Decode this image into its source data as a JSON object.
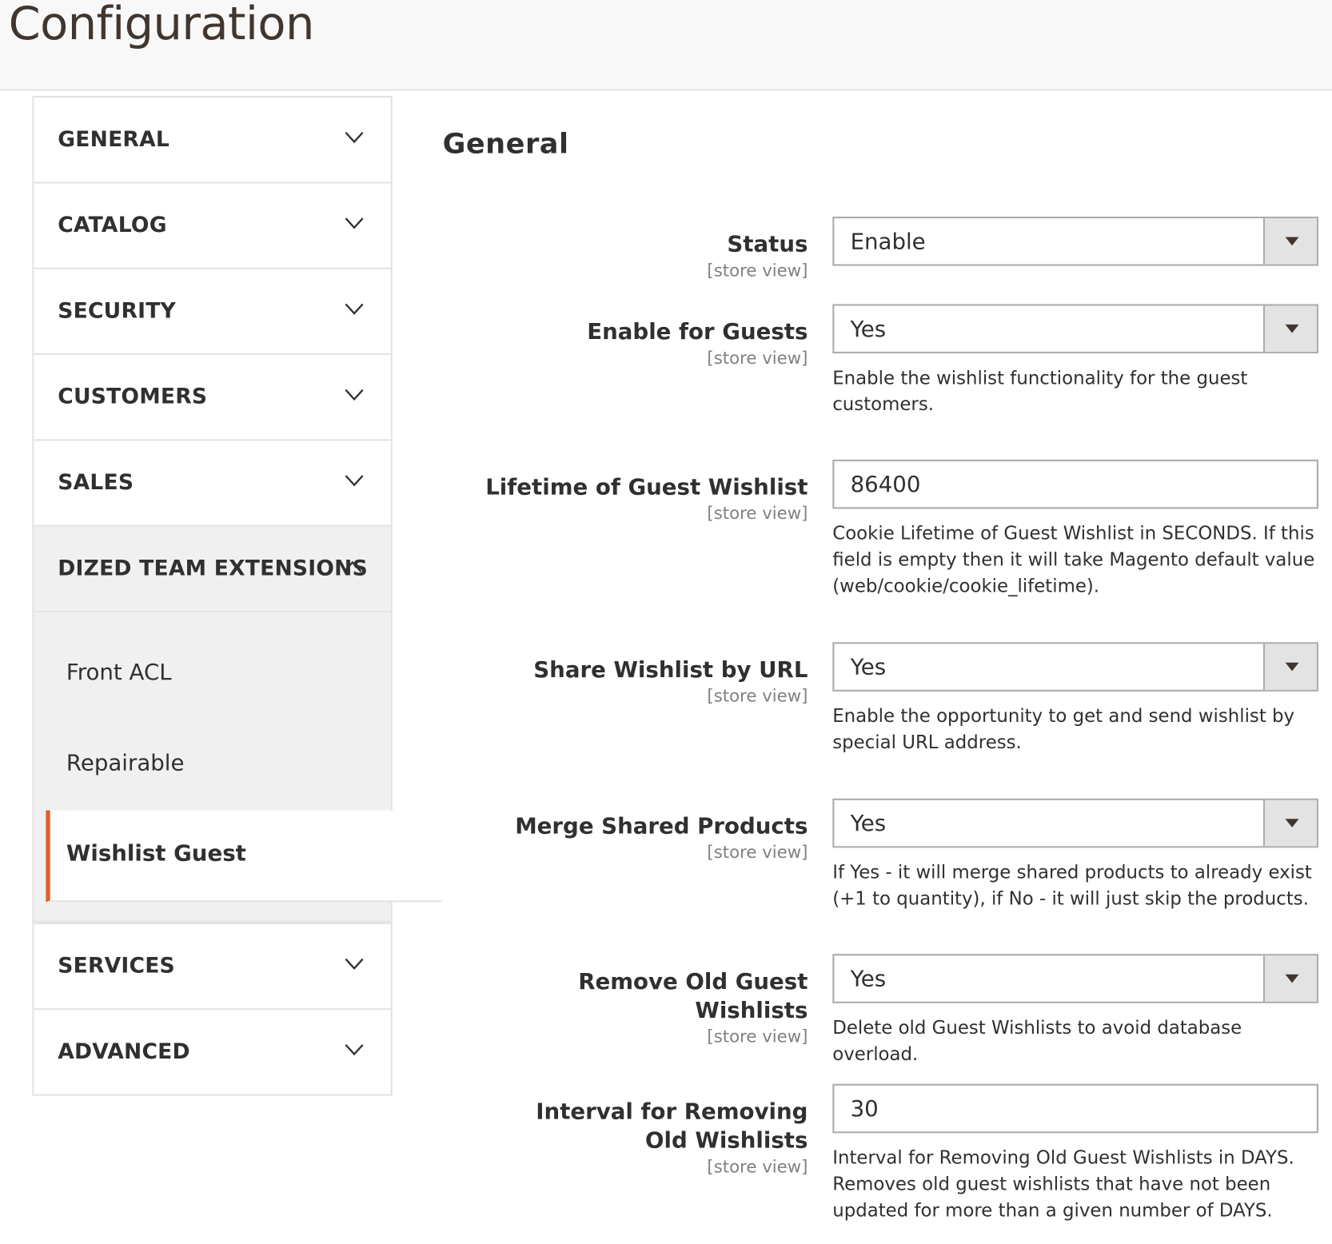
{
  "page": {
    "title": "Configuration"
  },
  "colors": {
    "accent": "#e05e27",
    "header_bg": "#f8f8f8",
    "nav_open_bg": "#f0f0f0",
    "border": "#e3e3e3"
  },
  "sidebar": {
    "groups_before": [
      {
        "label": "GENERAL",
        "icon": "chevron-down-icon"
      },
      {
        "label": "CATALOG",
        "icon": "chevron-down-icon"
      },
      {
        "label": "SECURITY",
        "icon": "chevron-down-icon"
      },
      {
        "label": "CUSTOMERS",
        "icon": "chevron-down-icon"
      },
      {
        "label": "SALES",
        "icon": "chevron-down-icon"
      }
    ],
    "open_group": {
      "label": "DIZED TEAM EXTENSIONS",
      "icon": "chevron-up-icon",
      "items": [
        {
          "label": "Front ACL",
          "active": false
        },
        {
          "label": "Repairable",
          "active": false
        },
        {
          "label": "Wishlist Guest",
          "active": true
        }
      ]
    },
    "groups_after": [
      {
        "label": "SERVICES",
        "icon": "chevron-down-icon"
      },
      {
        "label": "ADVANCED",
        "icon": "chevron-down-icon"
      }
    ]
  },
  "section": {
    "title": "General",
    "fields": [
      {
        "label": "Status",
        "scope": "[store view]",
        "type": "select",
        "value": "Enable",
        "note": ""
      },
      {
        "label": "Enable for Guests",
        "scope": "[store view]",
        "type": "select",
        "value": "Yes",
        "note": "Enable the wishlist functionality for the guest customers."
      },
      {
        "label": "Lifetime of Guest Wishlist",
        "scope": "[store view]",
        "type": "text",
        "value": "86400",
        "note": "Cookie Lifetime of Guest Wishlist in SECONDS. If this field is empty then it will take Magento default value (web/cookie/cookie_lifetime)."
      },
      {
        "label": "Share Wishlist by URL",
        "scope": "[store view]",
        "type": "select",
        "value": "Yes",
        "note": "Enable the opportunity to get and send wishlist by special URL address."
      },
      {
        "label": "Merge Shared Products",
        "scope": "[store view]",
        "type": "select",
        "value": "Yes",
        "note": "If Yes - it will merge shared products to already exist (+1 to quantity), if No - it will just skip the products."
      },
      {
        "label": "Remove Old Guest Wishlists",
        "scope": "[store view]",
        "type": "select",
        "value": "Yes",
        "note": "Delete old Guest Wishlists to avoid database overload."
      },
      {
        "label": "Interval for Removing Old Wishlists",
        "scope": "[store view]",
        "type": "text",
        "value": "30",
        "note": "Interval for Removing Old Guest Wishlists in DAYS. Removes old guest wishlists that have not been updated for more than a given number of DAYS."
      }
    ]
  }
}
